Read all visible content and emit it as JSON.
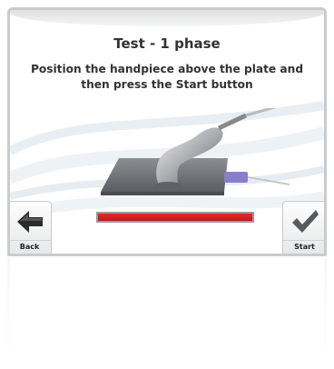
{
  "screen": {
    "title": "Test - 1 phase",
    "instruction": "Position the handpiece above the plate and then press the Start button"
  },
  "buttons": {
    "back": {
      "label": "Back",
      "icon": "arrow-left-icon"
    },
    "start": {
      "label": "Start",
      "icon": "checkmark-icon"
    }
  },
  "progress": {
    "value": 1.0,
    "fill_color": "#c0191b"
  },
  "colors": {
    "frame": "#c9cbcd",
    "text": "#333333"
  }
}
